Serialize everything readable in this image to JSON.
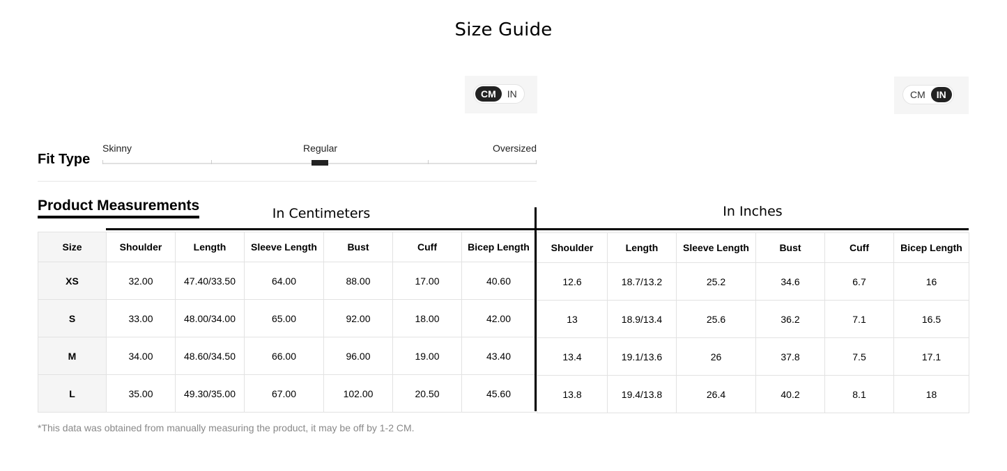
{
  "page": {
    "title": "Size Guide"
  },
  "unit_toggle_left": {
    "options": [
      "CM",
      "IN"
    ],
    "selected": "CM"
  },
  "unit_toggle_right": {
    "options": [
      "CM",
      "IN"
    ],
    "selected": "IN"
  },
  "fit": {
    "label": "Fit Type",
    "options": [
      "Skinny",
      "Regular",
      "Oversized"
    ],
    "selected": "Regular"
  },
  "measurements": {
    "title": "Product Measurements",
    "cm_label": "In Centimeters",
    "in_label": "In Inches",
    "footnote": "*This data was obtained from manually measuring the product, it may be off by 1-2 CM."
  },
  "cm_table": {
    "headers": [
      "Size",
      "Shoulder",
      "Length",
      "Sleeve Length",
      "Bust",
      "Cuff",
      "Bicep Length"
    ],
    "rows": [
      [
        "XS",
        "32.00",
        "47.40/33.50",
        "64.00",
        "88.00",
        "17.00",
        "40.60"
      ],
      [
        "S",
        "33.00",
        "48.00/34.00",
        "65.00",
        "92.00",
        "18.00",
        "42.00"
      ],
      [
        "M",
        "34.00",
        "48.60/34.50",
        "66.00",
        "96.00",
        "19.00",
        "43.40"
      ],
      [
        "L",
        "35.00",
        "49.30/35.00",
        "67.00",
        "102.00",
        "20.50",
        "45.60"
      ]
    ]
  },
  "in_table": {
    "headers": [
      "Shoulder",
      "Length",
      "Sleeve Length",
      "Bust",
      "Cuff",
      "Bicep Length"
    ],
    "rows": [
      [
        "12.6",
        "18.7/13.2",
        "25.2",
        "34.6",
        "6.7",
        "16"
      ],
      [
        "13",
        "18.9/13.4",
        "25.6",
        "36.2",
        "7.1",
        "16.5"
      ],
      [
        "13.4",
        "19.1/13.6",
        "26",
        "37.8",
        "7.5",
        "17.1"
      ],
      [
        "13.8",
        "19.4/13.8",
        "26.4",
        "40.2",
        "8.1",
        "18"
      ]
    ]
  }
}
